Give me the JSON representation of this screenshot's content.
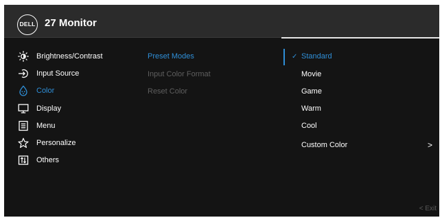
{
  "header": {
    "logo_text": "DELL",
    "title": "27 Monitor"
  },
  "menu": [
    {
      "label": "Brightness/Contrast",
      "icon": "brightness-icon",
      "active": false
    },
    {
      "label": "Input Source",
      "icon": "input-source-icon",
      "active": false
    },
    {
      "label": "Color",
      "icon": "color-palette-icon",
      "active": true
    },
    {
      "label": "Display",
      "icon": "display-icon",
      "active": false
    },
    {
      "label": "Menu",
      "icon": "menu-icon",
      "active": false
    },
    {
      "label": "Personalize",
      "icon": "star-icon",
      "active": false
    },
    {
      "label": "Others",
      "icon": "others-icon",
      "active": false
    }
  ],
  "submenu": [
    {
      "label": "Preset Modes",
      "active": true
    },
    {
      "label": "Input Color Format",
      "active": false
    },
    {
      "label": "Reset Color",
      "active": false
    }
  ],
  "options": [
    {
      "label": "Standard",
      "check": "✓",
      "selected": true
    },
    {
      "label": "Movie",
      "selected": false
    },
    {
      "label": "Game",
      "selected": false
    },
    {
      "label": "Warm",
      "selected": false
    },
    {
      "label": "Cool",
      "selected": false
    },
    {
      "label": "Custom Color",
      "arrow": ">",
      "selected": false
    }
  ],
  "footer": {
    "exit_label": "< Exit"
  },
  "colors": {
    "accent": "#2f8fd8",
    "background": "#141414",
    "header": "#2b2b2b",
    "disabled_text": "#5f5f5f"
  }
}
